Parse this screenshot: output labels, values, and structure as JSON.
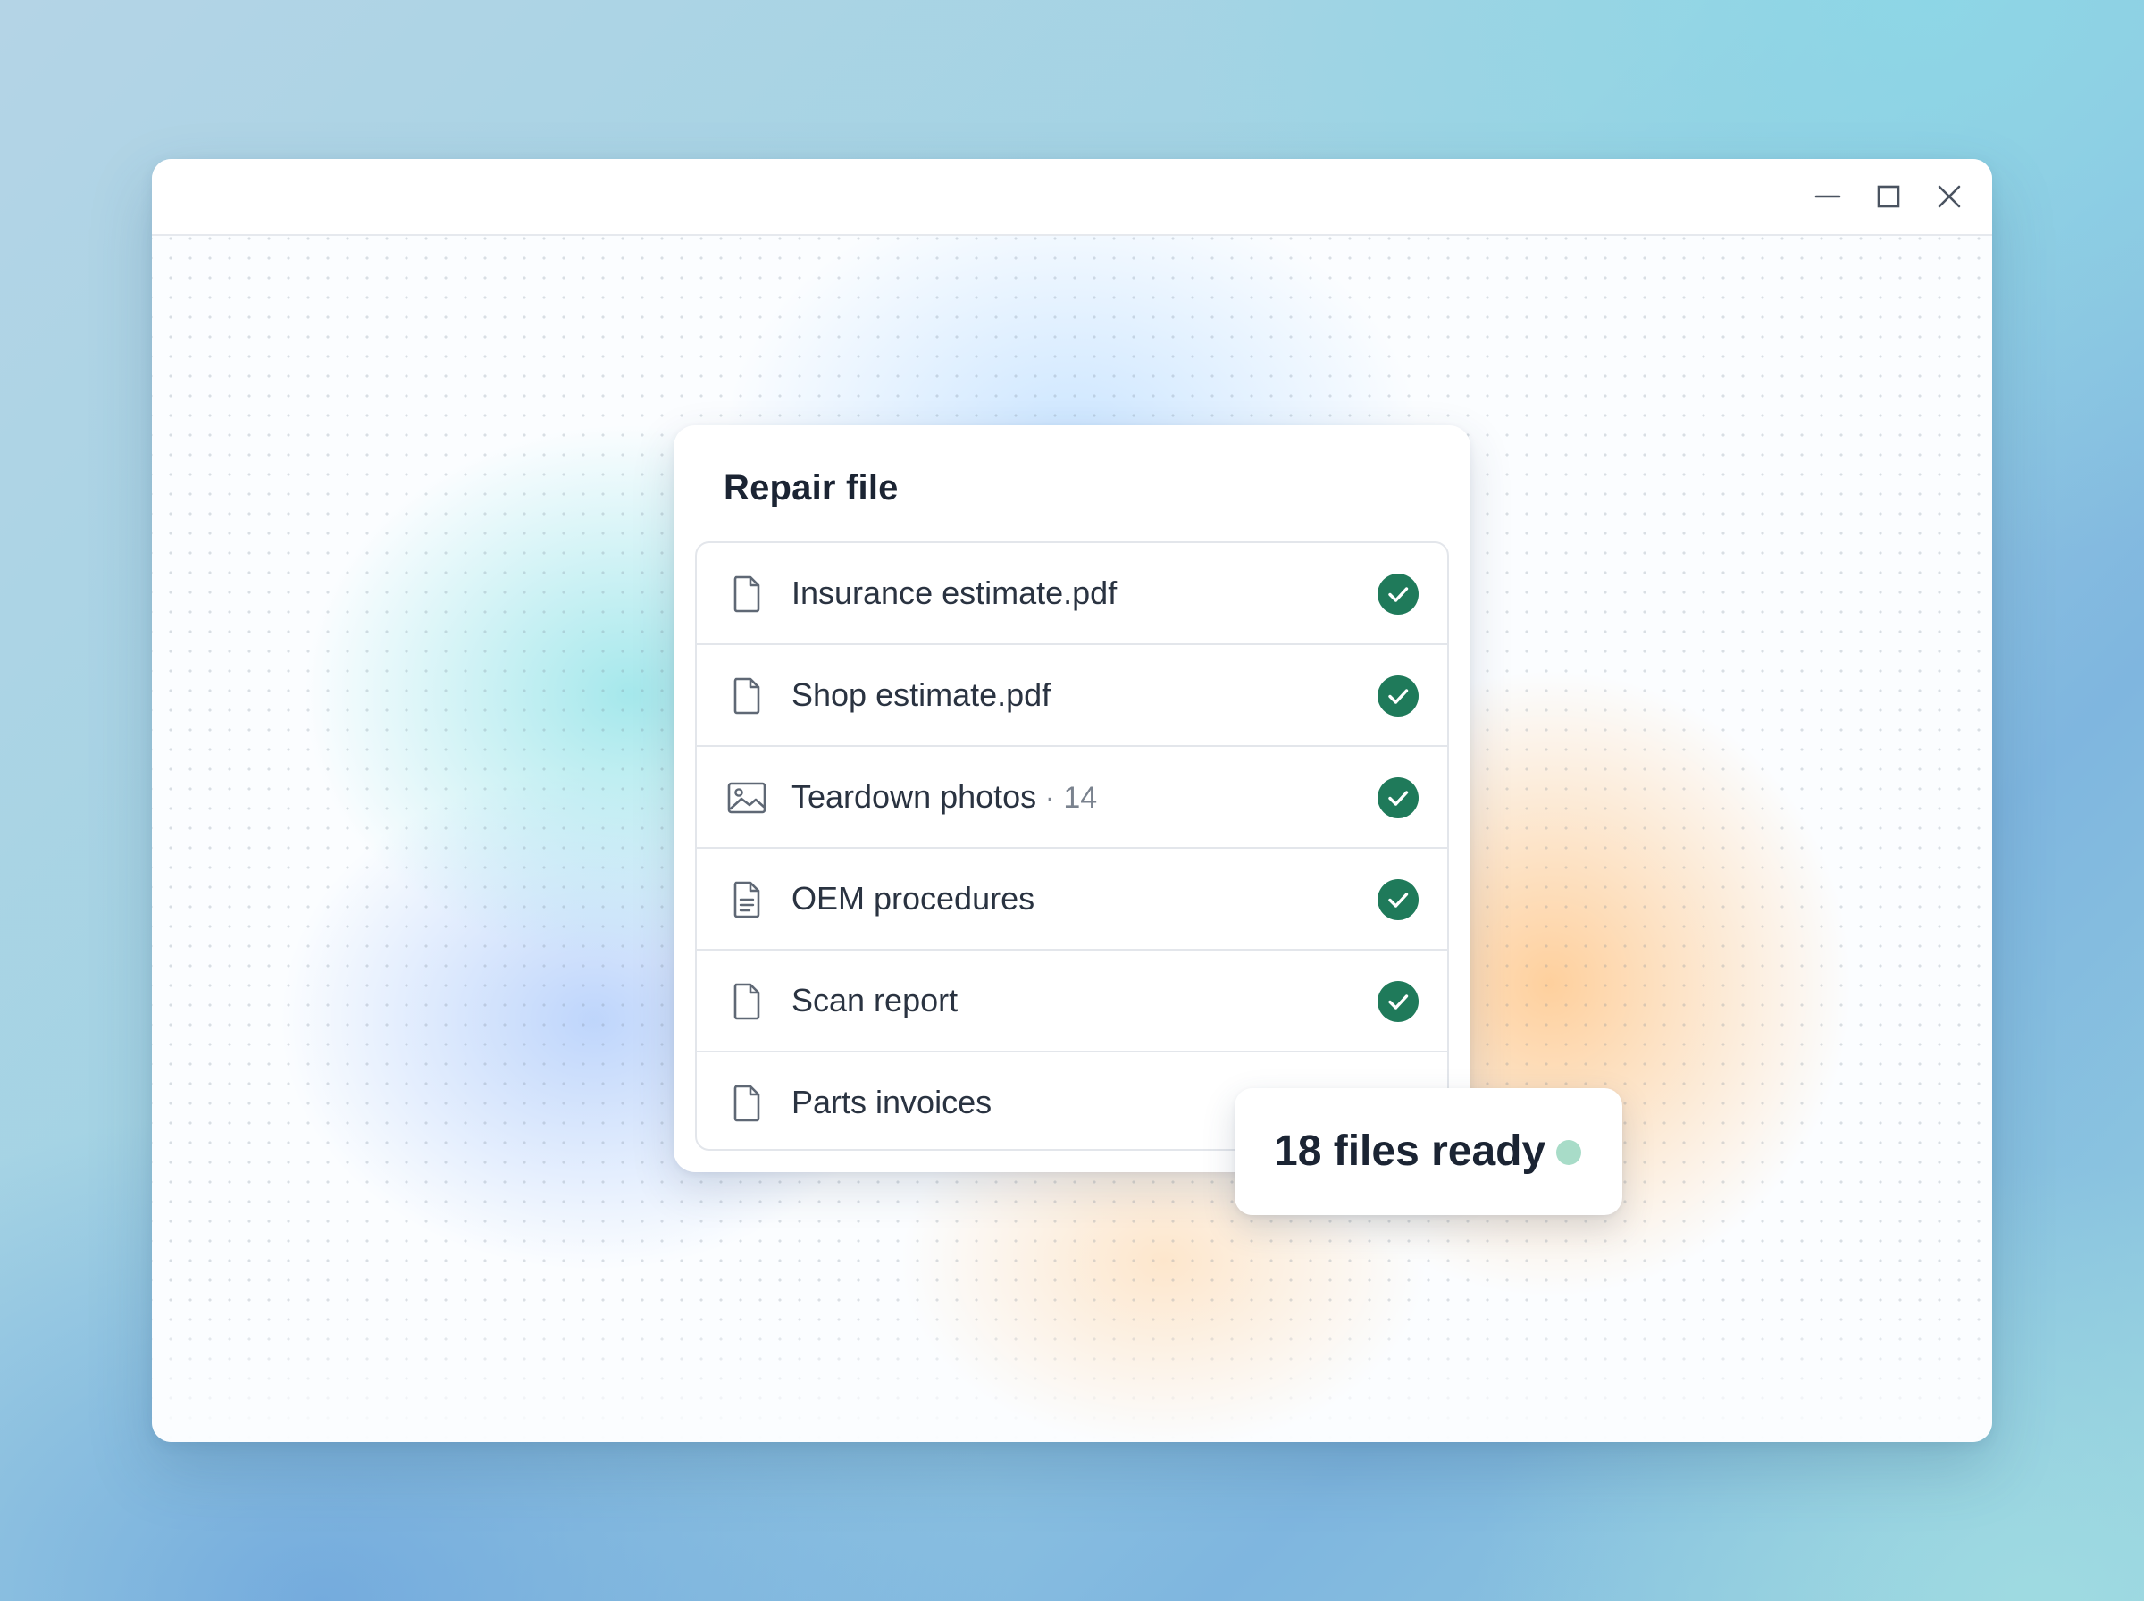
{
  "window": {
    "controls": {
      "minimize_icon": "minimize-icon",
      "maximize_icon": "maximize-icon",
      "close_icon": "close-icon"
    }
  },
  "card": {
    "title": "Repair file",
    "files": [
      {
        "label": "Insurance estimate.pdf",
        "count": "",
        "icon": "document-icon",
        "status": "complete"
      },
      {
        "label": "Shop estimate.pdf",
        "count": "",
        "icon": "document-icon",
        "status": "complete"
      },
      {
        "label": "Teardown photos",
        "count": " · 14",
        "icon": "image-icon",
        "status": "complete"
      },
      {
        "label": "OEM procedures",
        "count": "",
        "icon": "text-document-icon",
        "status": "complete"
      },
      {
        "label": "Scan report",
        "count": "",
        "icon": "document-icon",
        "status": "complete"
      },
      {
        "label": "Parts invoices",
        "count": "",
        "icon": "document-icon",
        "status": ""
      }
    ]
  },
  "status": {
    "text": "18 files ready"
  },
  "colors": {
    "check_green": "#1f7a5a",
    "status_dot": "#a8dcc8",
    "icon_stroke": "#5f6875"
  }
}
